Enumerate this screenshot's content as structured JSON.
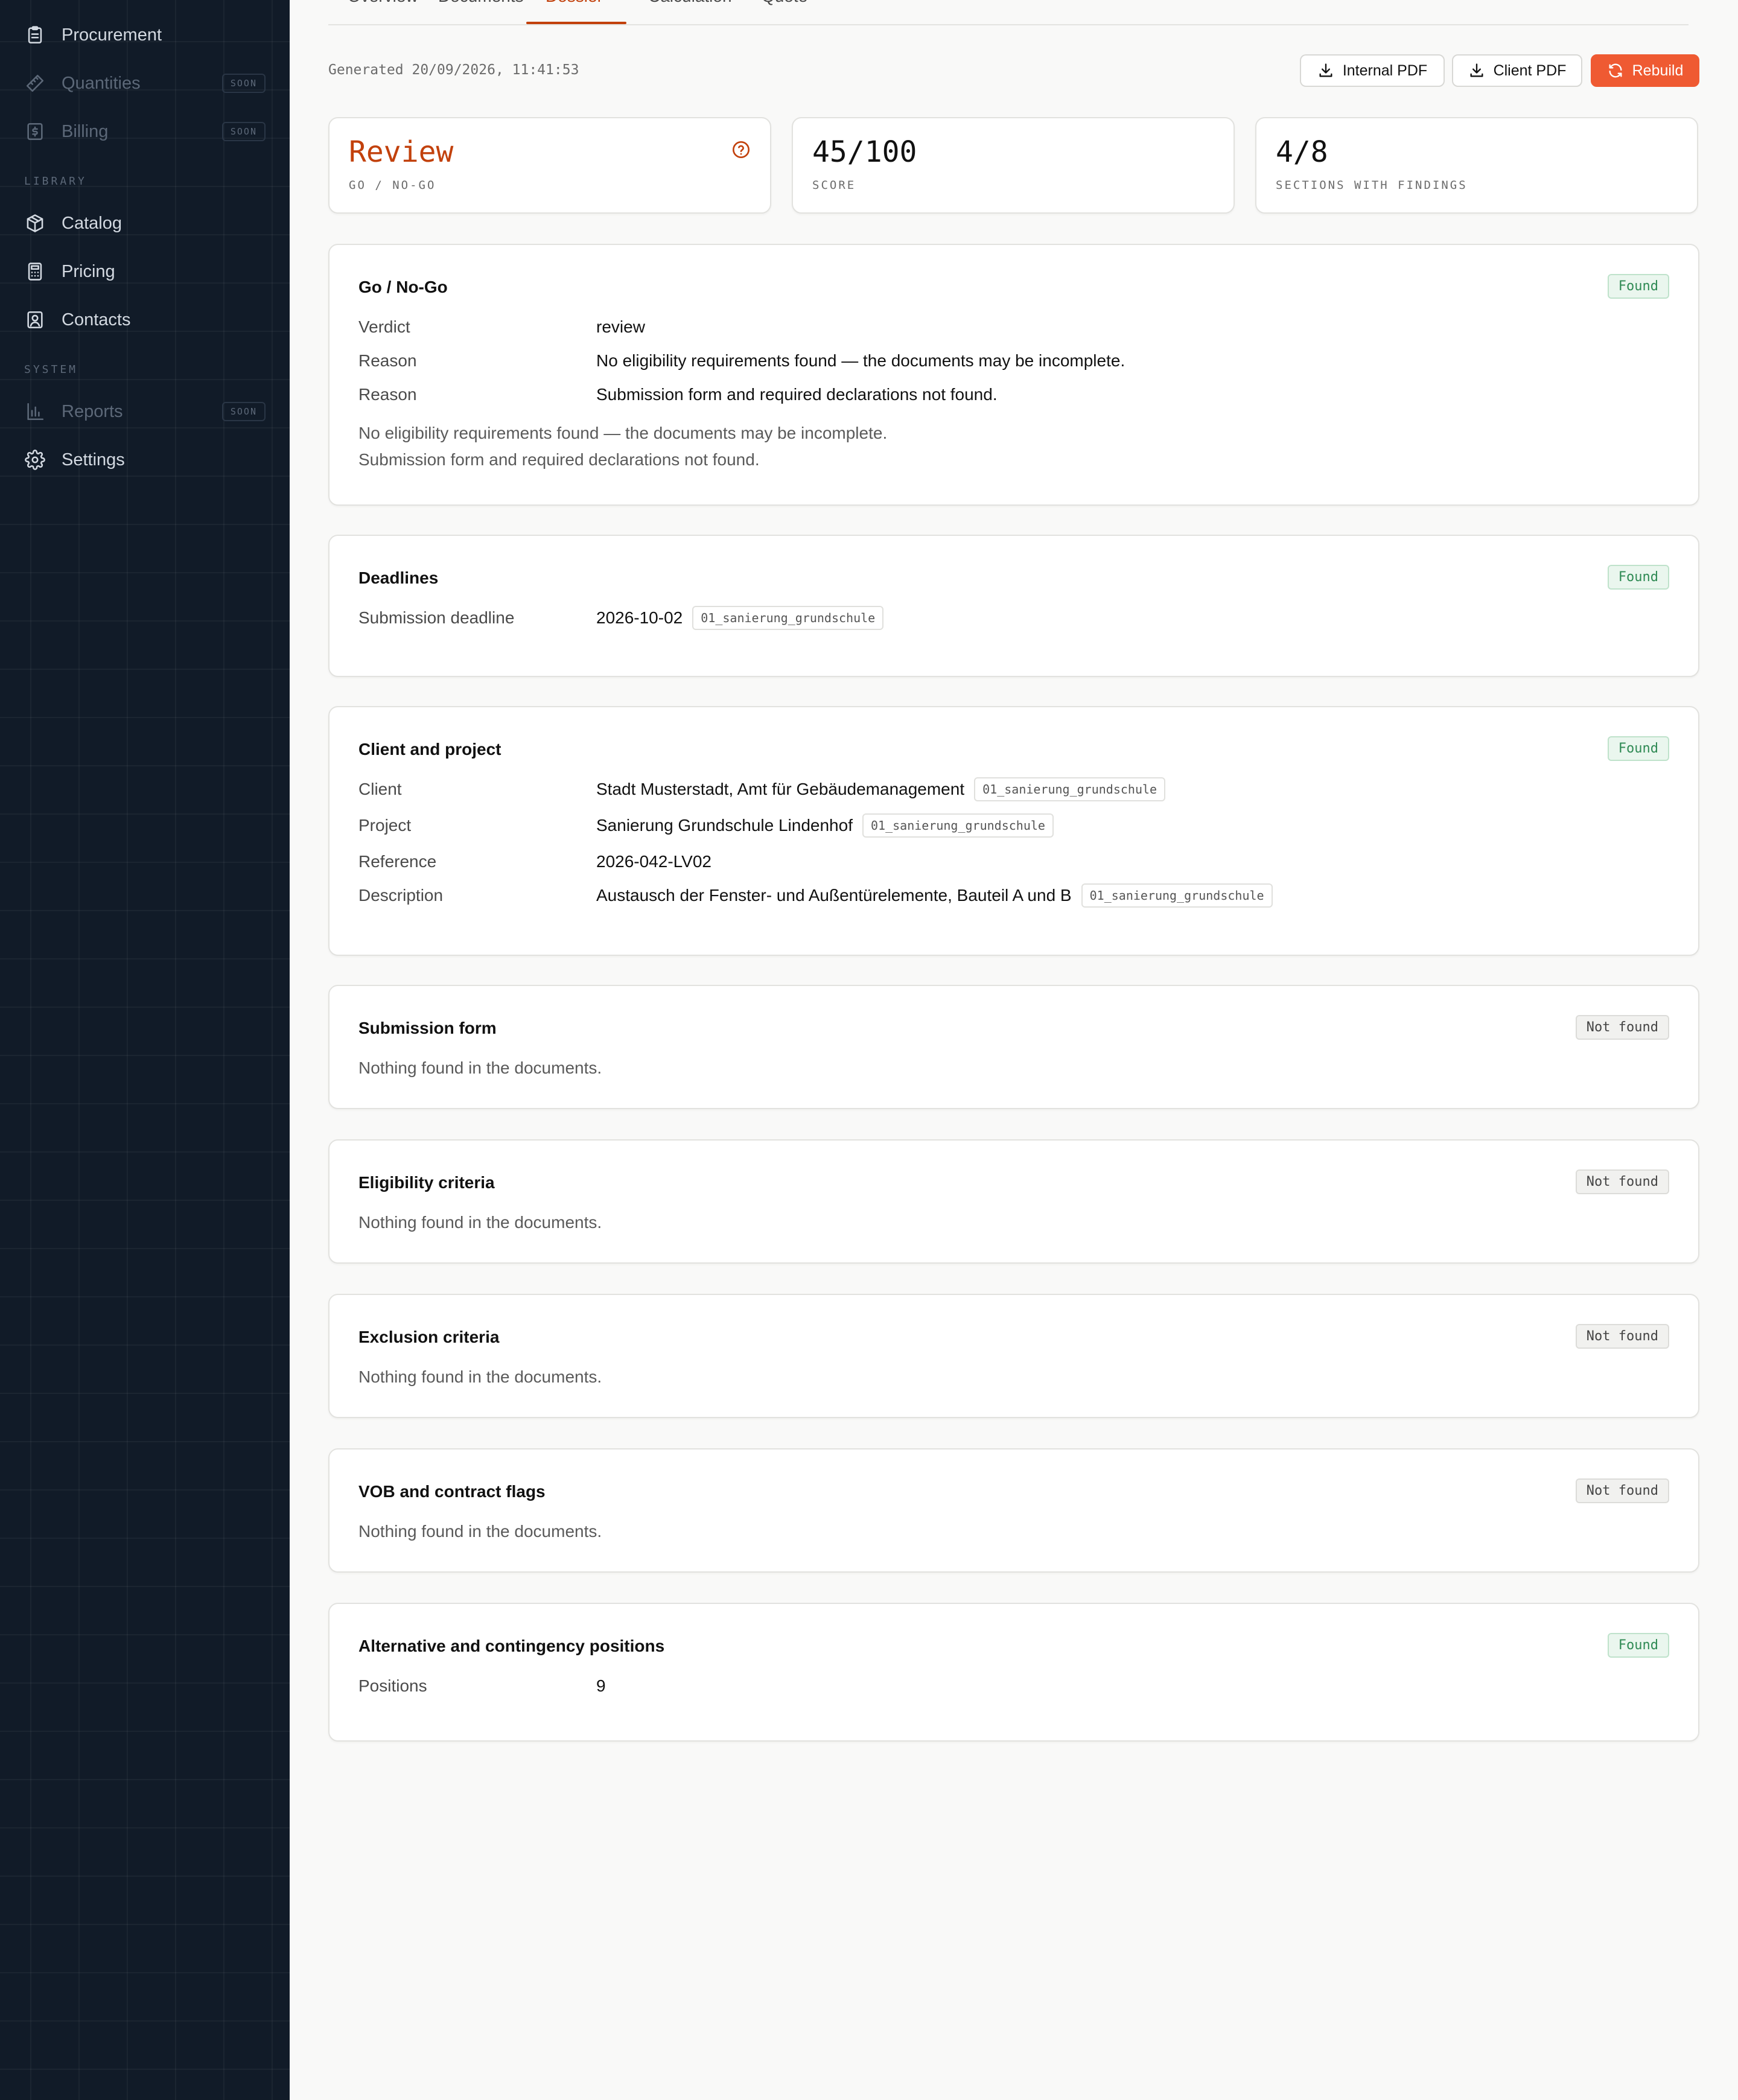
{
  "sidebar": {
    "items": [
      {
        "label": "Procurement",
        "icon": "clipboard-icon",
        "disabled": false
      },
      {
        "label": "Quantities",
        "icon": "ruler-icon",
        "disabled": true,
        "badge": "SOON"
      },
      {
        "label": "Billing",
        "icon": "dollar-receipt-icon",
        "disabled": true,
        "badge": "SOON"
      },
      {
        "label": "Catalog",
        "icon": "box-icon",
        "disabled": false
      },
      {
        "label": "Pricing",
        "icon": "calculator-icon",
        "disabled": false
      },
      {
        "label": "Contacts",
        "icon": "contact-card-icon",
        "disabled": false
      },
      {
        "label": "Reports",
        "icon": "bar-chart-icon",
        "disabled": true,
        "badge": "SOON"
      },
      {
        "label": "Settings",
        "icon": "gear-icon",
        "disabled": false
      }
    ],
    "sections": {
      "library": "LIBRARY",
      "system": "SYSTEM"
    }
  },
  "tabs": [
    "Overview",
    "Documents",
    "Dossier",
    "Calculation",
    "Quote"
  ],
  "active_tab": "Dossier",
  "generated": "Generated 20/09/2026, 11:41:53",
  "actions": {
    "internal_pdf": "Internal PDF",
    "client_pdf": "Client PDF",
    "rebuild": "Rebuild"
  },
  "stats": {
    "verdict": {
      "value": "Review",
      "caption": "GO / NO-GO"
    },
    "score": {
      "value": "45/100",
      "caption": "SCORE"
    },
    "findings": {
      "value": "4/8",
      "caption": "SECTIONS WITH FINDINGS"
    }
  },
  "colors": {
    "accent": "#ef5a32",
    "review": "#c2410c",
    "found": "#2f8a54",
    "sidebar": "#111b28"
  },
  "sections": {
    "gonogo": {
      "title": "Go / No-Go",
      "badge": "Found",
      "rows": [
        {
          "k": "Verdict",
          "v": "review"
        },
        {
          "k": "Reason",
          "v": "No eligibility requirements found — the documents may be incomplete."
        },
        {
          "k": "Reason",
          "v": "Submission form and required declarations not found."
        }
      ],
      "notes": [
        "No eligibility requirements found — the documents may be incomplete.",
        "Submission form and required declarations not found."
      ]
    },
    "deadlines": {
      "title": "Deadlines",
      "badge": "Found",
      "rows": [
        {
          "k": "Submission deadline",
          "v": "2026-10-02",
          "src": "01_sanierung_grundschule"
        }
      ]
    },
    "client": {
      "title": "Client and project",
      "badge": "Found",
      "rows": [
        {
          "k": "Client",
          "v": "Stadt Musterstadt, Amt für Gebäudemanagement",
          "src": "01_sanierung_grundschule"
        },
        {
          "k": "Project",
          "v": "Sanierung Grundschule Lindenhof",
          "src": "01_sanierung_grundschule"
        },
        {
          "k": "Reference",
          "v": "2026-042-LV02"
        },
        {
          "k": "Description",
          "v": "Austausch der Fenster- und Außentürelemente, Bauteil A und B",
          "src": "01_sanierung_grundschule"
        }
      ]
    },
    "submission": {
      "title": "Submission form",
      "badge": "Not found",
      "note": "Nothing found in the documents."
    },
    "eligibility": {
      "title": "Eligibility criteria",
      "badge": "Not found",
      "note": "Nothing found in the documents."
    },
    "exclusion": {
      "title": "Exclusion criteria",
      "badge": "Not found",
      "note": "Nothing found in the documents."
    },
    "vob": {
      "title": "VOB and contract flags",
      "badge": "Not found",
      "note": "Nothing found in the documents."
    },
    "alternative": {
      "title": "Alternative and contingency positions",
      "badge": "Found",
      "rows": [
        {
          "k": "Positions",
          "v": "9"
        }
      ]
    }
  }
}
